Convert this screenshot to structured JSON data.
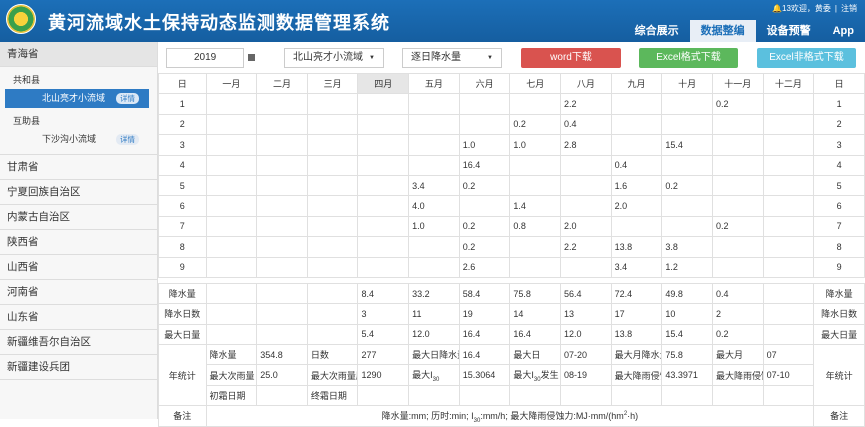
{
  "header": {
    "title": "黄河流域水土保持动态监测数据管理系统",
    "bell_count": "13",
    "welcome": "欢迎，黄委",
    "logout": "注销",
    "nav": [
      {
        "label": "综合展示",
        "active": false
      },
      {
        "label": "数据整编",
        "active": true
      },
      {
        "label": "设备预警",
        "active": false
      },
      {
        "label": "App",
        "active": false
      }
    ]
  },
  "sidebar": {
    "first_province": "青海省",
    "counties": [
      {
        "name": "共和县",
        "basin": {
          "name": "北山亮才小流域",
          "badge": "详情",
          "selected": true
        }
      },
      {
        "name": "互助县",
        "basin": {
          "name": "下沙沟小流域",
          "badge": "详情",
          "selected": false
        }
      }
    ],
    "provinces": [
      "甘肃省",
      "宁夏回族自治区",
      "内蒙古自治区",
      "陕西省",
      "山西省",
      "河南省",
      "山东省",
      "新疆维吾尔自治区",
      "新疆建设兵团"
    ]
  },
  "toolbar": {
    "year": "2019",
    "basin_select": "北山亮才小流域",
    "type_select": "逐日降水量",
    "word_btn": "word下载",
    "excel_btn": "Excel格式下载",
    "excel2_btn": "Excel非格式下载"
  },
  "table": {
    "headers": [
      "日",
      "一月",
      "二月",
      "三月",
      "四月",
      "五月",
      "六月",
      "七月",
      "八月",
      "九月",
      "十月",
      "十一月",
      "十二月",
      "日"
    ],
    "rows": [
      [
        "1",
        "",
        "",
        "",
        "",
        "",
        "",
        "",
        "2.2",
        "",
        "",
        "0.2",
        "",
        "1"
      ],
      [
        "2",
        "",
        "",
        "",
        "",
        "",
        "",
        "0.2",
        "0.4",
        "",
        "",
        "",
        "",
        "2"
      ],
      [
        "3",
        "",
        "",
        "",
        "",
        "",
        "1.0",
        "1.0",
        "2.8",
        "",
        "15.4",
        "",
        "",
        "3"
      ],
      [
        "4",
        "",
        "",
        "",
        "",
        "",
        "16.4",
        "",
        "",
        "0.4",
        "",
        "",
        "",
        "4"
      ],
      [
        "5",
        "",
        "",
        "",
        "",
        "3.4",
        "0.2",
        "",
        "",
        "1.6",
        "0.2",
        "",
        "",
        "5"
      ],
      [
        "6",
        "",
        "",
        "",
        "",
        "4.0",
        "",
        "1.4",
        "",
        "2.0",
        "",
        "",
        "",
        "6"
      ],
      [
        "7",
        "",
        "",
        "",
        "",
        "1.0",
        "0.2",
        "0.8",
        "2.0",
        "",
        "",
        "0.2",
        "",
        "7"
      ],
      [
        "8",
        "",
        "",
        "",
        "",
        "",
        "0.2",
        "",
        "2.2",
        "13.8",
        "3.8",
        "",
        "",
        "8"
      ],
      [
        "9",
        "",
        "",
        "",
        "",
        "",
        "2.6",
        "",
        "",
        "3.4",
        "1.2",
        "",
        "",
        "9"
      ]
    ],
    "summary": [
      [
        "降水量",
        "",
        "",
        "",
        "8.4",
        "33.2",
        "58.4",
        "75.8",
        "56.4",
        "72.4",
        "49.8",
        "0.4",
        "",
        "降水量"
      ],
      [
        "降水日数",
        "",
        "",
        "",
        "3",
        "11",
        "19",
        "14",
        "13",
        "17",
        "10",
        "2",
        "",
        "降水日数"
      ],
      [
        "最大日量",
        "",
        "",
        "",
        "5.4",
        "12.0",
        "16.4",
        "16.4",
        "12.0",
        "13.8",
        "15.4",
        "0.2",
        "",
        "最大日量"
      ]
    ],
    "annual_label": "年统计",
    "annual": {
      "r1": [
        "降水量",
        "354.8",
        "日数",
        "277",
        "最大日降水量",
        "16.4",
        "最大日",
        "07-20",
        "最大月降水量",
        "75.8",
        "最大月",
        "07"
      ],
      "r2": [
        "最大次雨量",
        "25.0",
        "最大次雨量历时",
        "1290",
        "最大I30",
        "15.3064",
        "最大I30发生",
        "08-19",
        "最大降雨侵蚀力",
        "43.3971",
        "最大降雨侵蚀力",
        "07-10"
      ],
      "r3": [
        "初霜日期",
        "",
        "终霜日期",
        "",
        "",
        "",
        "",
        "",
        "",
        "",
        "",
        ""
      ]
    },
    "remark_label": "备注",
    "remark_text": "降水量:mm; 历时:min; I30:mm/h; 最大降雨侵蚀力:MJ·mm/(hm2·h)"
  }
}
